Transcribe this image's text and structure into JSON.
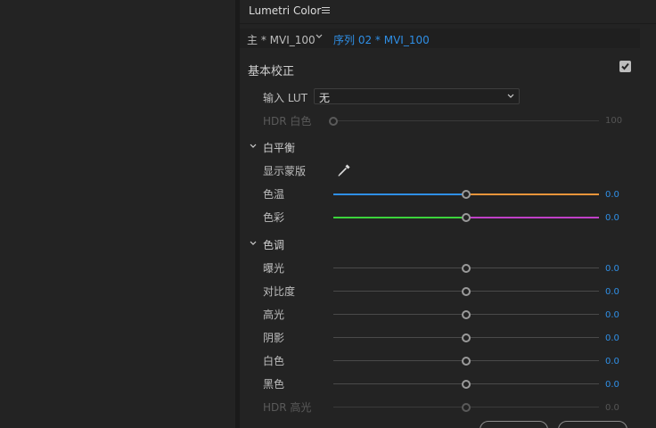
{
  "panel": {
    "title": "Lumetri Color"
  },
  "clip": {
    "master": "主 * MVI_100",
    "sequence": "序列 02 * MVI_100"
  },
  "basic": {
    "title": "基本校正",
    "enabled": true,
    "lut_label": "输入 LUT",
    "lut_value": "无",
    "hdr_white_label": "HDR 白色",
    "hdr_white_value": "100",
    "hdr_white_level": 0
  },
  "white_balance": {
    "title": "白平衡",
    "mask_label": "显示蒙版",
    "temperature": {
      "label": "色温",
      "value": "0.0",
      "level": 0.5
    },
    "tint": {
      "label": "色彩",
      "value": "0.0",
      "level": 0.5
    }
  },
  "tone": {
    "title": "色调",
    "sliders": [
      {
        "label": "曝光",
        "value": "0.0",
        "level": 0.5
      },
      {
        "label": "对比度",
        "value": "0.0",
        "level": 0.5
      },
      {
        "label": "高光",
        "value": "0.0",
        "level": 0.5
      },
      {
        "label": "阴影",
        "value": "0.0",
        "level": 0.5
      },
      {
        "label": "白色",
        "value": "0.0",
        "level": 0.5
      },
      {
        "label": "黑色",
        "value": "0.0",
        "level": 0.5
      },
      {
        "label": "HDR 高光",
        "value": "0.0",
        "level": 0.5
      }
    ]
  },
  "colors": {
    "accent": "#2f8fe6",
    "temp_cool": "#2f8fe6",
    "temp_warm": "#e8943a",
    "tint_green": "#3cd33c",
    "tint_magenta": "#c040c8"
  },
  "icons": {
    "menu": "hamburger-menu-icon",
    "chevron": "chevron-down-icon",
    "checkbox": "checkmark-icon",
    "eyedropper": "eyedropper-icon"
  }
}
